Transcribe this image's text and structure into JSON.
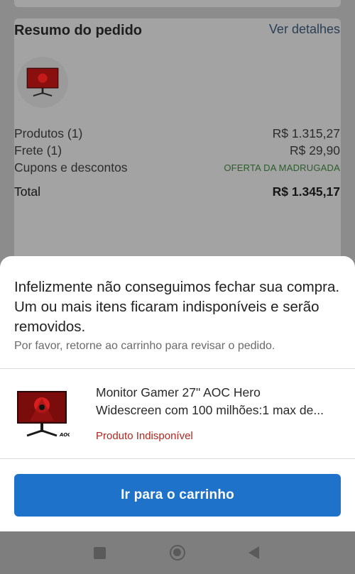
{
  "order_summary": {
    "title": "Resumo do pedido",
    "details_link": "Ver detalhes",
    "rows": [
      {
        "label": "Produtos (1)",
        "value": "R$ 1.315,27"
      },
      {
        "label": "Frete (1)",
        "value": "R$ 29,90"
      },
      {
        "label": "Cupons e descontos",
        "value": "OFERTA DA MADRUGADA"
      }
    ],
    "total": {
      "label": "Total",
      "value": "R$ 1.345,17"
    }
  },
  "sheet": {
    "title": "Infelizmente não conseguimos fechar sua compra. Um ou mais itens ficaram indisponíveis e serão removidos.",
    "subtitle": "Por favor, retorne ao carrinho para revisar o pedido.",
    "item": {
      "name_line1": "Monitor Gamer 27\" AOC Hero",
      "name_line2": "Widescreen com 100 milhões:1 max de...",
      "status": "Produto Indisponível",
      "brand_mark": "AOC"
    },
    "cart_button_label": "Ir para o carrinho"
  },
  "nav": {
    "icons": [
      "recents-square-icon",
      "home-circle-icon",
      "back-triangle-icon"
    ]
  },
  "colors": {
    "primary_button": "#1f72c9",
    "unavailable_text": "#b3261e",
    "promo_text": "#2b5d2b",
    "link": "#2a3f56"
  }
}
